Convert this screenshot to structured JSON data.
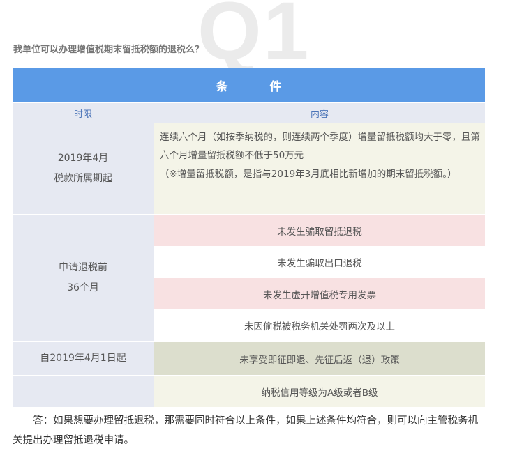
{
  "watermark": "Q1",
  "question": "我单位可以办理增值税期末留抵税额的退税么？",
  "table": {
    "header": "条件",
    "col_time": "时限",
    "col_content": "内容",
    "row1": {
      "time_line1": "2019年4月",
      "time_line2": "税款所属期起",
      "content_line1": "连续六个月（如按季纳税的，则连续两个季度）增量留抵税额均大于零，且第六个月增量留抵税额不低于50万元",
      "content_line2": "（※增量留抵税额，是指与2019年3月底相比新增加的期末留抵税额。）"
    },
    "row2": {
      "time_line1": "申请退税前",
      "time_line2": "36个月",
      "items": [
        "未发生骗取留抵退税",
        "未发生骗取出口退税",
        "未发生虚开增值税专用发票",
        "未因偷税被税务机关处罚两次及以上"
      ]
    },
    "row3": {
      "time": "自2019年4月1日起",
      "content": "未享受即征即退、先征后返（退）政策"
    },
    "row4": {
      "time": "",
      "content": "纳税信用等级为A级或者B级"
    }
  },
  "answer": "答：如果想要办理留抵退税，那需要同时符合以上条件，如果上述条件均符合，则可以向主管税务机关提出办理留抵退税申请。"
}
